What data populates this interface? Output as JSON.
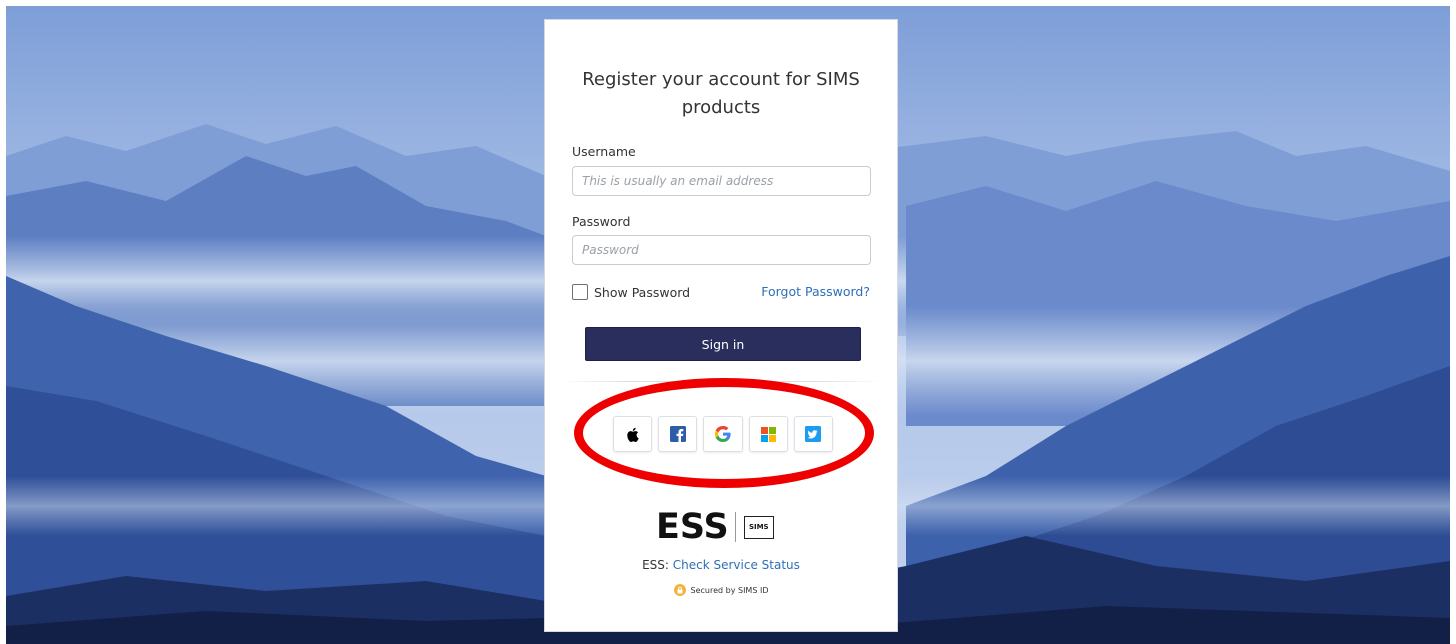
{
  "form": {
    "title": "Register your account for SIMS products",
    "username_label": "Username",
    "username_placeholder": "This is usually an email address",
    "username_value": "",
    "password_label": "Password",
    "password_placeholder": "Password",
    "password_value": "",
    "show_password_label": "Show Password",
    "forgot_password_label": "Forgot Password?",
    "sign_in_label": "Sign in"
  },
  "social": [
    {
      "name": "apple-icon"
    },
    {
      "name": "facebook-icon"
    },
    {
      "name": "google-icon"
    },
    {
      "name": "microsoft-icon"
    },
    {
      "name": "twitter-icon"
    }
  ],
  "footer": {
    "logo_text": "ESS",
    "logo_badge": "SIMS",
    "status_prefix": "ESS: ",
    "status_link": "Check Service Status",
    "secured_text": "Secured by SIMS ID"
  },
  "colors": {
    "sign_in_bg": "#2a2e5c",
    "link": "#2e6fb8",
    "highlight": "#ee0000"
  }
}
